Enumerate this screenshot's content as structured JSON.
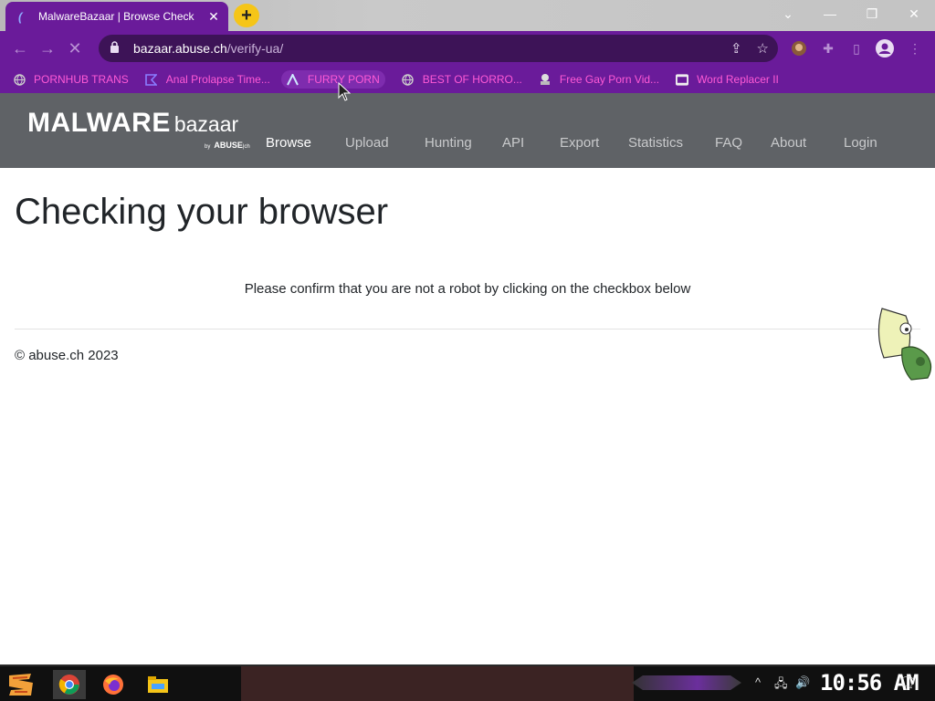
{
  "browser": {
    "tab": {
      "title": "MalwareBazaar | Browse Check",
      "close": "✕"
    },
    "new_tab": "+",
    "window_controls": {
      "minimize": "—",
      "restore": "❐",
      "close": "✕",
      "dropdown": "⌄"
    },
    "url": {
      "host": "bazaar.abuse.ch",
      "path": "/verify-ua/"
    },
    "bookmarks": [
      {
        "label": "PORNHUB TRANS",
        "icon": "globe-icon"
      },
      {
        "label": "Anal Prolapse Time...",
        "icon": "bookmark-icon"
      },
      {
        "label": "FURRY PORN",
        "icon": "a-logo-icon"
      },
      {
        "label": "BEST OF HORRO...",
        "icon": "globe-icon"
      },
      {
        "label": "Free Gay Porn Vid...",
        "icon": "site-icon"
      },
      {
        "label": "Word Replacer II",
        "icon": "wr-icon"
      }
    ]
  },
  "site": {
    "logo": {
      "main": "MALWARE",
      "sub": "bazaar",
      "by_small": "by",
      "by": "ABUSE",
      "by_suffix": "|ch"
    },
    "nav": [
      {
        "label": "Browse",
        "active": true
      },
      {
        "label": "Upload",
        "active": false
      },
      {
        "label": "Hunting",
        "active": false
      },
      {
        "label": "API",
        "active": false
      },
      {
        "label": "Export",
        "active": false
      },
      {
        "label": "Statistics",
        "active": false
      },
      {
        "label": "FAQ",
        "active": false
      },
      {
        "label": "About",
        "active": false
      },
      {
        "label": "Login",
        "active": false
      }
    ]
  },
  "content": {
    "title": "Checking your browser",
    "prompt": "Please confirm that you are not a robot by clicking on the checkbox below",
    "footer": "© abuse.ch 2023"
  },
  "taskbar": {
    "clock": "10:56 AM"
  },
  "colors": {
    "chrome_purple": "#6a1b9a",
    "bookmark_pink": "#ff5ad6",
    "site_header": "#5f6266",
    "new_tab_yellow": "#f5c518"
  }
}
